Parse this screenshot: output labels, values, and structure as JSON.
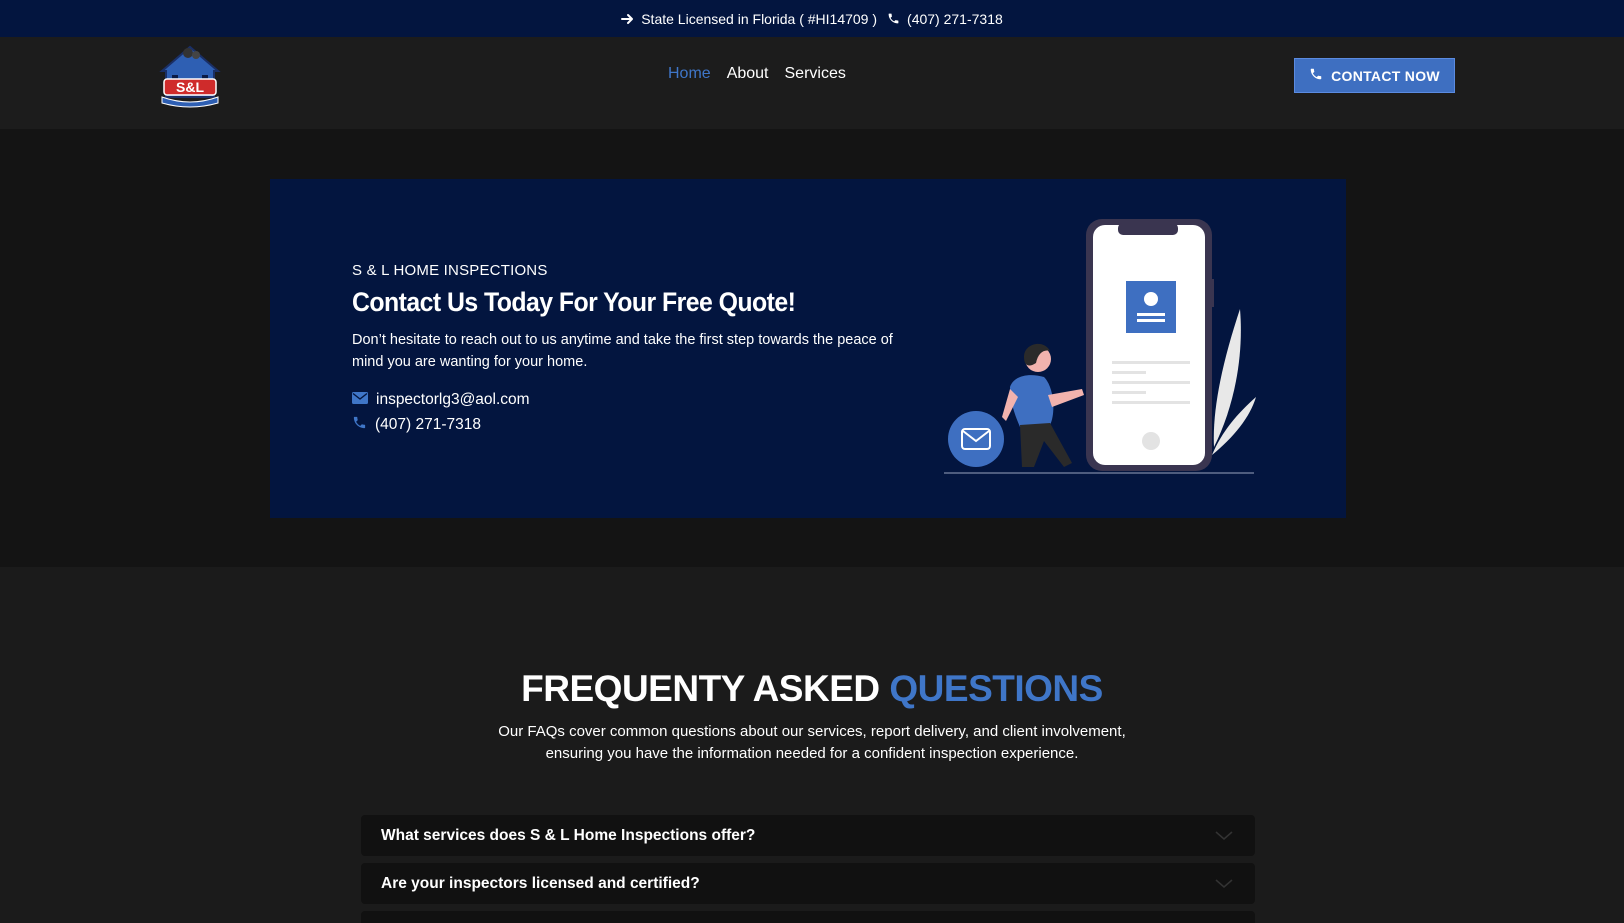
{
  "topbar": {
    "license_text": "State Licensed in Florida ( #HI14709 )",
    "phone": "(407) 271-7318",
    "arrow_icon": "arrow-right-icon",
    "phone_icon": "phone-icon"
  },
  "header": {
    "logo_text": "S&L",
    "nav": {
      "home": "Home",
      "about": "About",
      "services": "Services"
    },
    "cta_label": "CONTACT NOW"
  },
  "hero": {
    "eyebrow": "S & L HOME INSPECTIONS",
    "title": "Contact Us Today For Your Free Quote!",
    "description": "Don’t hesitate to reach out to us anytime and take the first step towards the peace of mind you are wanting for your home.",
    "email": "inspectorlg3@aol.com",
    "phone": "(407) 271-7318"
  },
  "faq": {
    "title_main": "FREQUENTY ASKED ",
    "title_accent": "QUESTIONS",
    "subtitle": "Our FAQs cover common questions about our services, report delivery, and client involvement, ensuring you have the information needed for a confident inspection experience.",
    "items": [
      "What services does S & L Home Inspections offer?",
      "Are your inspectors licensed and certified?"
    ]
  },
  "colors": {
    "navy": "#03153f",
    "accent": "#3f76c8",
    "background": "#171717"
  }
}
